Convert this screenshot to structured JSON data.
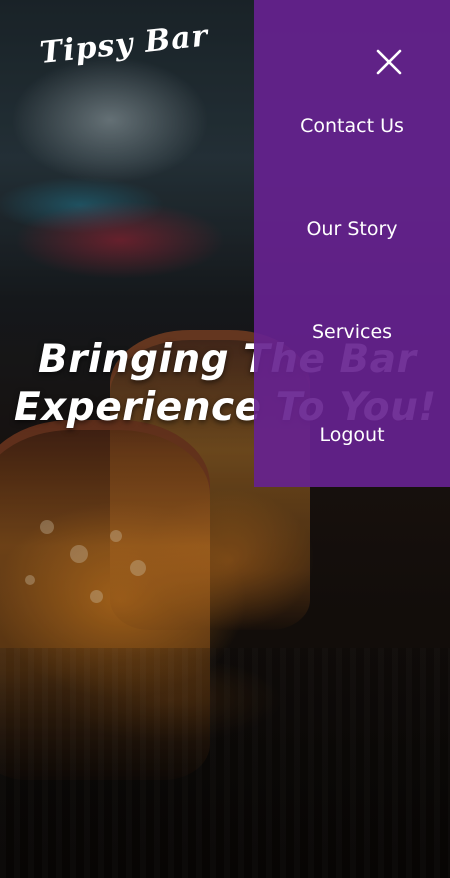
{
  "brand": {
    "logo_text": "Tipsy Bar"
  },
  "hero": {
    "headline_line1": "Bringing The Bar",
    "headline_line2": "Experience To You!"
  },
  "menu": {
    "close_icon": "close-icon",
    "items": [
      {
        "label": "Contact Us"
      },
      {
        "label": "Our Story"
      },
      {
        "label": "Services"
      },
      {
        "label": "Logout"
      }
    ]
  },
  "colors": {
    "menu_background": "#66228f",
    "text": "#ffffff"
  }
}
